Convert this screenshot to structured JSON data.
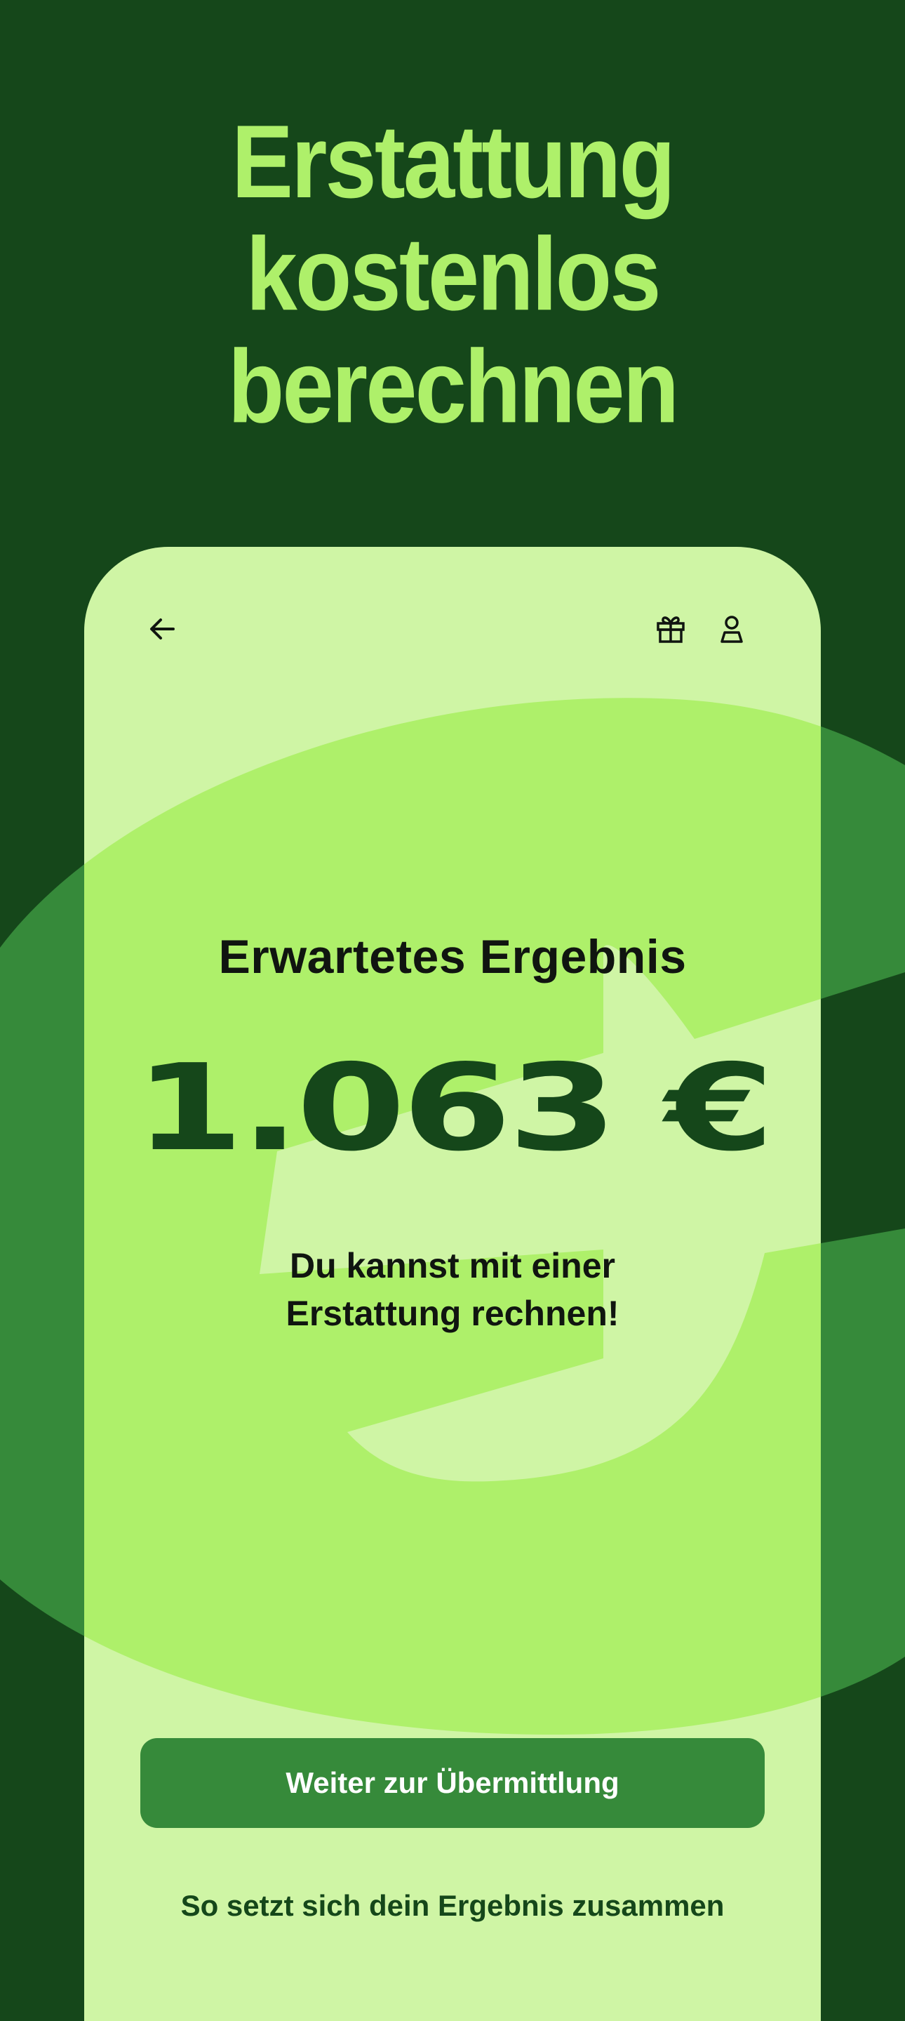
{
  "promo": {
    "headline_lines": [
      "Erstattung",
      "kostenlos",
      "berechnen"
    ]
  },
  "colors": {
    "background": "#15471a",
    "accent": "#aef06a",
    "card": "#cff5a5",
    "primary_button": "#368a3a",
    "euro_shape_dark": "#368a3a",
    "euro_shape_light": "#aef06a"
  },
  "top_bar": {
    "back_icon": "arrow-left-icon",
    "gift_icon": "gift-icon",
    "profile_icon": "user-icon"
  },
  "result": {
    "title": "Erwartetes Ergebnis",
    "amount": "1.063 €",
    "subtitle_lines": [
      "Du kannst mit einer",
      "Erstattung rechnen!"
    ]
  },
  "actions": {
    "primary_label": "Weiter zur Übermittlung",
    "secondary_label": "So setzt sich dein Ergebnis zusammen"
  }
}
